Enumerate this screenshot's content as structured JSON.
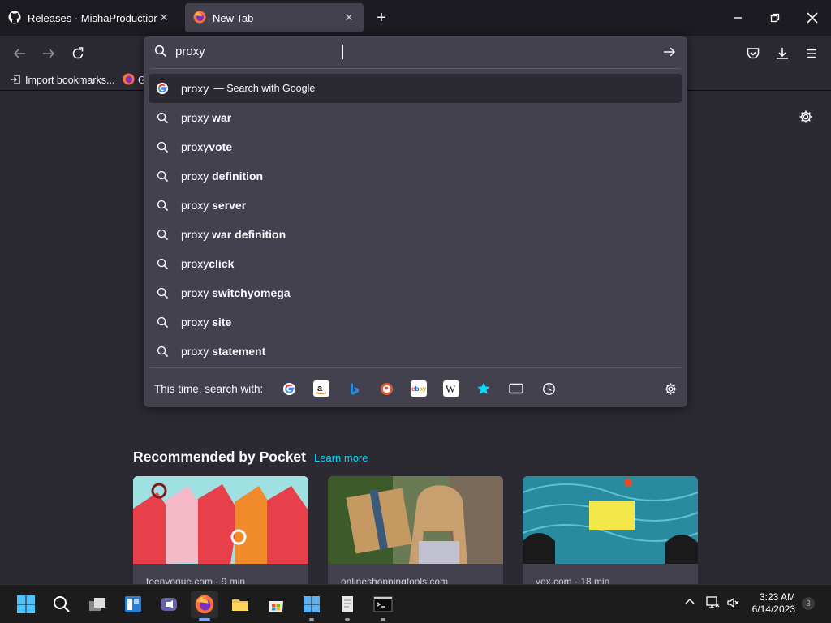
{
  "tabs": [
    {
      "title": "Releases · MishaProductions/Re"
    },
    {
      "title": "New Tab"
    }
  ],
  "bookmarks": {
    "import": "Import bookmarks...",
    "second": "G"
  },
  "urlbar": {
    "value": "proxy"
  },
  "suggestions": [
    {
      "prefix": "proxy",
      "suffix": "",
      "note": "— Search with Google",
      "icon": "google-icon"
    },
    {
      "prefix": "proxy ",
      "suffix": "war"
    },
    {
      "prefix": "proxy",
      "suffix": "vote"
    },
    {
      "prefix": "proxy ",
      "suffix": "definition"
    },
    {
      "prefix": "proxy ",
      "suffix": "server"
    },
    {
      "prefix": "proxy ",
      "suffix": "war definition"
    },
    {
      "prefix": "proxy",
      "suffix": "click"
    },
    {
      "prefix": "proxy ",
      "suffix": "switchyomega"
    },
    {
      "prefix": "proxy ",
      "suffix": "site"
    },
    {
      "prefix": "proxy ",
      "suffix": "statement"
    }
  ],
  "oneoff": {
    "label": "This time, search with:",
    "engines": [
      "google",
      "amazon",
      "bing",
      "duckduckgo",
      "ebay",
      "wikipedia",
      "bookmarks",
      "tabs",
      "history"
    ]
  },
  "pocket": {
    "title": "Recommended by Pocket",
    "learn_more": "Learn more",
    "cards": [
      {
        "source": "teenvogue.com · 9 min"
      },
      {
        "source": "onlineshoppingtools.com"
      },
      {
        "source": "vox.com · 18 min"
      }
    ]
  },
  "clock": {
    "time": "3:23 AM",
    "date": "6/14/2023"
  },
  "notifications": "3",
  "colors": {
    "accent": "#00ddff",
    "popup_bg": "#42414d",
    "page_bg": "#2b2a33",
    "tabstrip_bg": "#1c1b22"
  }
}
